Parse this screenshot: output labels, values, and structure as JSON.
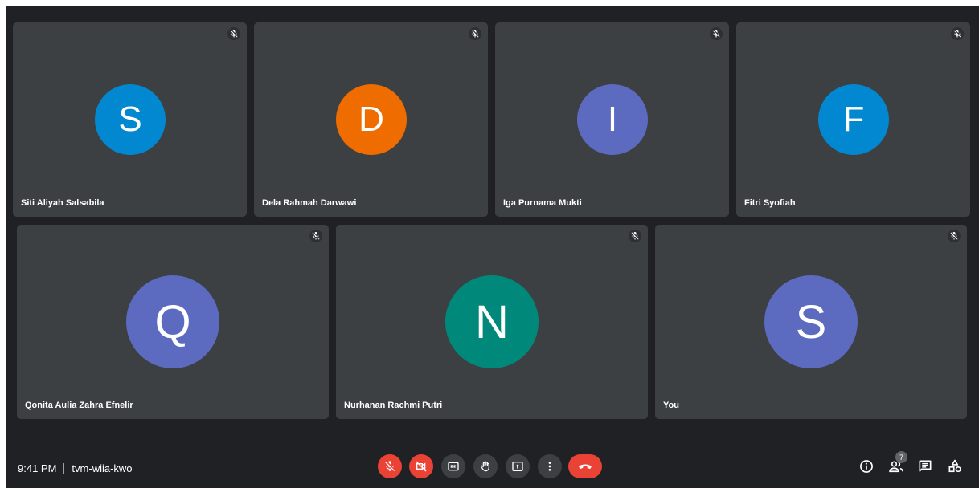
{
  "colors": {
    "background": "#202124",
    "tile": "#3c4043",
    "danger": "#ea4335"
  },
  "participants_row1": [
    {
      "initial": "S",
      "name": "Siti Aliyah Salsabila",
      "color": "#0288d1",
      "muted": true
    },
    {
      "initial": "D",
      "name": "Dela Rahmah Darwawi",
      "color": "#ef6c00",
      "muted": true
    },
    {
      "initial": "I",
      "name": "Iga Purnama Mukti",
      "color": "#5c6bc0",
      "muted": true
    },
    {
      "initial": "F",
      "name": "Fitri Syofiah",
      "color": "#0288d1",
      "muted": true
    }
  ],
  "participants_row2": [
    {
      "initial": "Q",
      "name": "Qonita Aulia Zahra Efnelir",
      "color": "#5c6bc0",
      "muted": true
    },
    {
      "initial": "N",
      "name": "Nurhanan Rachmi Putri",
      "color": "#00897b",
      "muted": true
    },
    {
      "initial": "S",
      "name": "You",
      "color": "#5c6bc0",
      "muted": true
    }
  ],
  "meeting": {
    "time": "9:41 PM",
    "code": "tvm-wiia-kwo"
  },
  "controls": [
    {
      "icon": "mic-off-icon",
      "style": "red"
    },
    {
      "icon": "camera-off-icon",
      "style": "red"
    },
    {
      "icon": "captions-icon",
      "style": "gray"
    },
    {
      "icon": "raise-hand-icon",
      "style": "gray"
    },
    {
      "icon": "present-screen-icon",
      "style": "gray"
    },
    {
      "icon": "more-options-icon",
      "style": "gray"
    },
    {
      "icon": "hang-up-icon",
      "style": "red"
    }
  ],
  "side_panel": {
    "people_count": "7",
    "icons": [
      "info-icon",
      "people-icon",
      "chat-icon",
      "activities-icon"
    ]
  }
}
